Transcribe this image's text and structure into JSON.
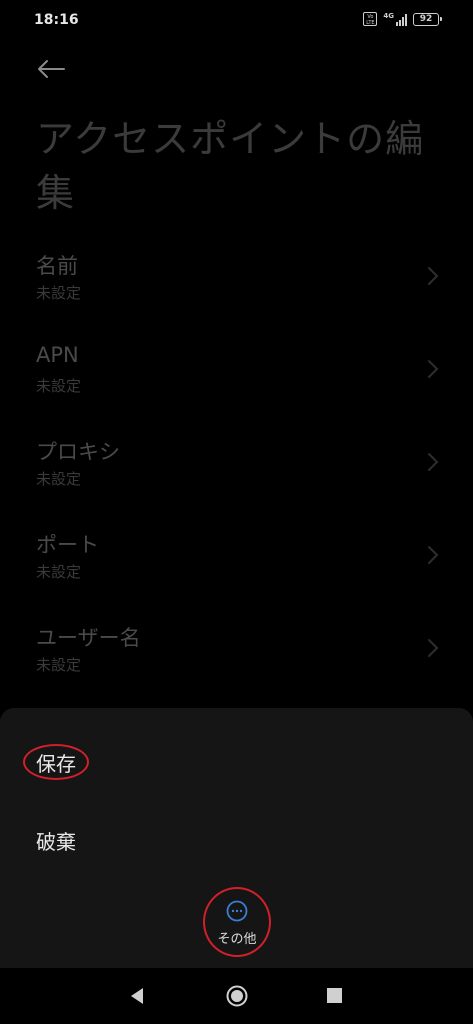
{
  "status_bar": {
    "time": "18:16",
    "volte_top": "Vo",
    "volte_bottom": "LTE",
    "network_type": "4G",
    "battery_level": "92",
    "signal_bars": 4
  },
  "header": {
    "back_icon": "arrow-left-icon",
    "title": "アクセスポイントの編集"
  },
  "settings": {
    "items": [
      {
        "label": "名前",
        "value": "未設定"
      },
      {
        "label": "APN",
        "value": "未設定"
      },
      {
        "label": "プロキシ",
        "value": "未設定"
      },
      {
        "label": "ポート",
        "value": "未設定"
      },
      {
        "label": "ユーザー名",
        "value": "未設定"
      }
    ]
  },
  "action_sheet": {
    "save_label": "保存",
    "discard_label": "破棄",
    "more_label": "その他",
    "more_icon": "more-dots-icon"
  },
  "colors": {
    "background": "#000000",
    "sheet": "#151515",
    "dim_text": "#4a4a4a",
    "highlight_red": "#d0202a",
    "more_icon_blue": "#3b7fd4"
  }
}
